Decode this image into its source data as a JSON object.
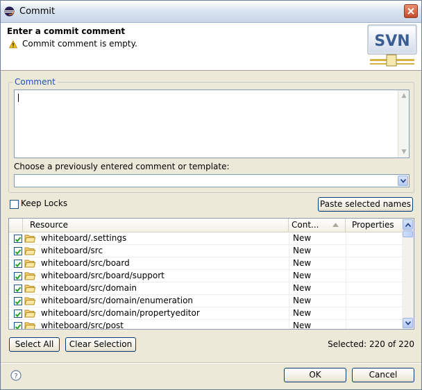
{
  "window": {
    "title": "Commit"
  },
  "banner": {
    "title": "Enter a commit comment",
    "message": "Commit comment is empty.",
    "logo_text": "SVN"
  },
  "comment": {
    "group_label": "Comment",
    "value": "",
    "choose_label": "Choose a previously entered comment or template:",
    "template_value": ""
  },
  "options": {
    "keep_locks_label": "Keep Locks",
    "keep_locks_checked": false,
    "paste_button": "Paste selected names"
  },
  "table": {
    "columns": [
      "Resource",
      "Cont...",
      "Properties"
    ],
    "rows": [
      {
        "path": "whiteboard/.settings",
        "status": "New",
        "checked": true
      },
      {
        "path": "whiteboard/src",
        "status": "New",
        "checked": true
      },
      {
        "path": "whiteboard/src/board",
        "status": "New",
        "checked": true
      },
      {
        "path": "whiteboard/src/board/support",
        "status": "New",
        "checked": true
      },
      {
        "path": "whiteboard/src/domain",
        "status": "New",
        "checked": true
      },
      {
        "path": "whiteboard/src/domain/enumeration",
        "status": "New",
        "checked": true
      },
      {
        "path": "whiteboard/src/domain/propertyeditor",
        "status": "New",
        "checked": true
      },
      {
        "path": "whiteboard/src/post",
        "status": "New",
        "checked": true
      }
    ]
  },
  "selection": {
    "select_all": "Select All",
    "clear_selection": "Clear Selection",
    "summary": "Selected: 220 of 220"
  },
  "footer": {
    "ok": "OK",
    "cancel": "Cancel"
  },
  "colors": {
    "label_blue": "#2050c0",
    "title_gradient_end": "#c8d6e8"
  }
}
